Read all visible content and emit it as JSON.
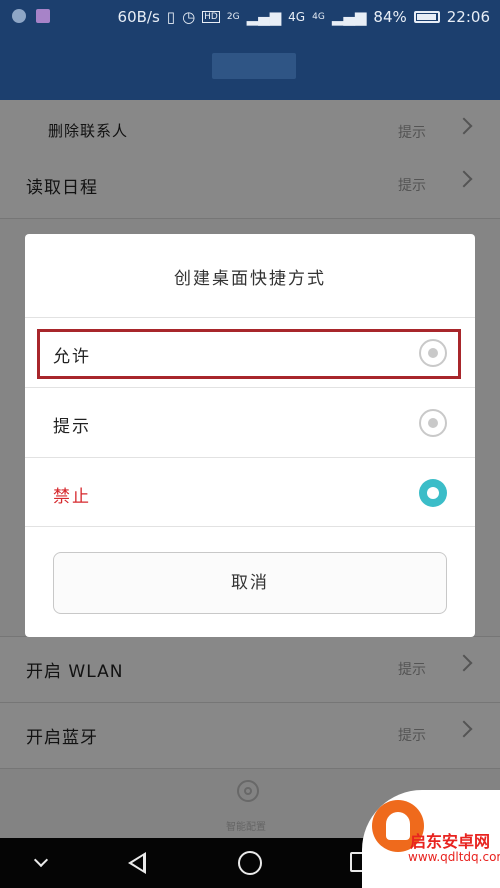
{
  "status_bar": {
    "net_speed": "60B/s",
    "hd": "HD",
    "net1": "2G",
    "net2": "4G",
    "net3": "4G",
    "battery": "84%",
    "time": "22:06"
  },
  "list": {
    "rows": [
      {
        "label": "删除联系人",
        "hint": "提示"
      },
      {
        "label": "读取日程",
        "hint": "提示"
      },
      {
        "label": "开启 WLAN",
        "hint": "提示"
      },
      {
        "label": "开启蓝牙",
        "hint": "提示"
      }
    ],
    "footer_label": "智能配置"
  },
  "dialog": {
    "title": "创建桌面快捷方式",
    "options": [
      {
        "label": "允许",
        "selected": false,
        "color": "#222222"
      },
      {
        "label": "提示",
        "selected": false,
        "color": "#222222"
      },
      {
        "label": "禁止",
        "selected": true,
        "color": "#d6282d"
      }
    ],
    "cancel_label": "取消",
    "accent_color": "#3bbdc8",
    "highlight_color": "#a8262b"
  },
  "watermark": {
    "name": "启东安卓网",
    "url": "www.qdltdq.com"
  }
}
